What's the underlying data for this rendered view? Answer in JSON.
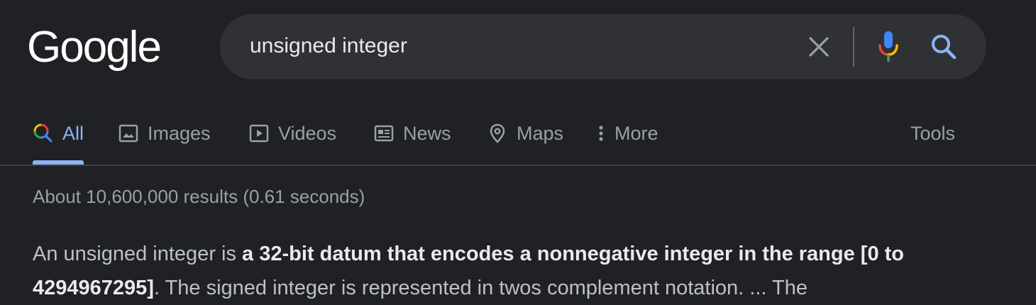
{
  "logo": {
    "text": "Google"
  },
  "search": {
    "query": "unsigned integer",
    "icons": {
      "clear": "close-icon",
      "voice": "microphone-icon",
      "submit": "search-icon"
    }
  },
  "tabs": [
    {
      "label": "All",
      "icon": "search-icon",
      "active": true
    },
    {
      "label": "Images",
      "icon": "image-icon",
      "active": false
    },
    {
      "label": "Videos",
      "icon": "play-icon",
      "active": false
    },
    {
      "label": "News",
      "icon": "newspaper-icon",
      "active": false
    },
    {
      "label": "Maps",
      "icon": "map-pin-icon",
      "active": false
    },
    {
      "label": "More",
      "icon": "kebab-menu-icon",
      "active": false
    }
  ],
  "tools_label": "Tools",
  "result_stats": "About 10,600,000 results (0.61 seconds)",
  "snippet": {
    "part1": "An unsigned integer is ",
    "bold1": "a 32-bit datum that encodes a nonnegative integer in the range [0 to 4294967295]",
    "part2": ". The signed integer is represented in twos complement notation. ... The"
  },
  "colors": {
    "background": "#202124",
    "search_bg": "#303134",
    "accent": "#8ab4f8",
    "text_primary": "#e8eaed",
    "text_secondary": "#9aa0a6",
    "snippet_text": "#bdc1c6",
    "mic_blue": "#4285f4",
    "mic_red": "#ea4335",
    "mic_yellow": "#fbbc05",
    "mic_green": "#34a853"
  }
}
